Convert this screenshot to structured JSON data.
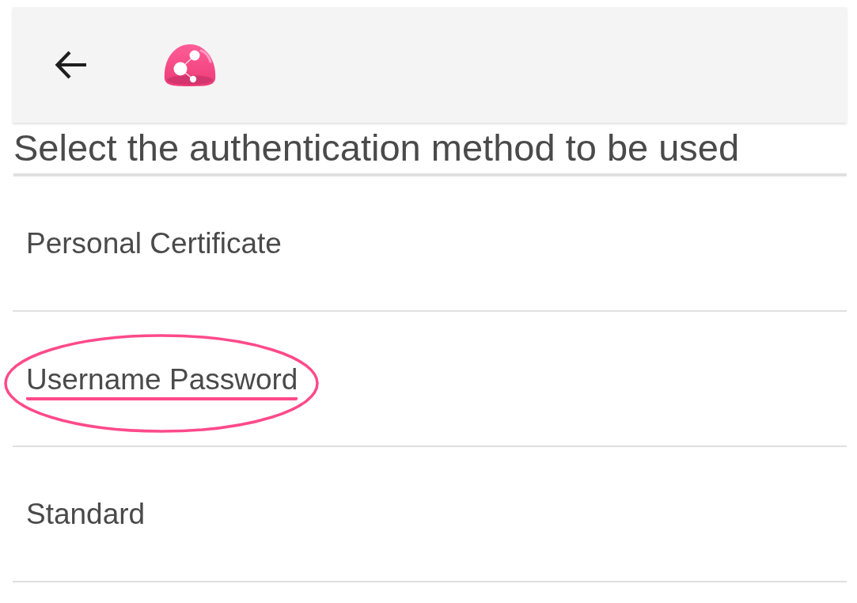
{
  "heading": "Select the authentication method to be used",
  "methods": [
    {
      "label": "Personal Certificate",
      "highlighted": false
    },
    {
      "label": "Username Password",
      "highlighted": true
    },
    {
      "label": "Standard",
      "highlighted": false
    }
  ]
}
